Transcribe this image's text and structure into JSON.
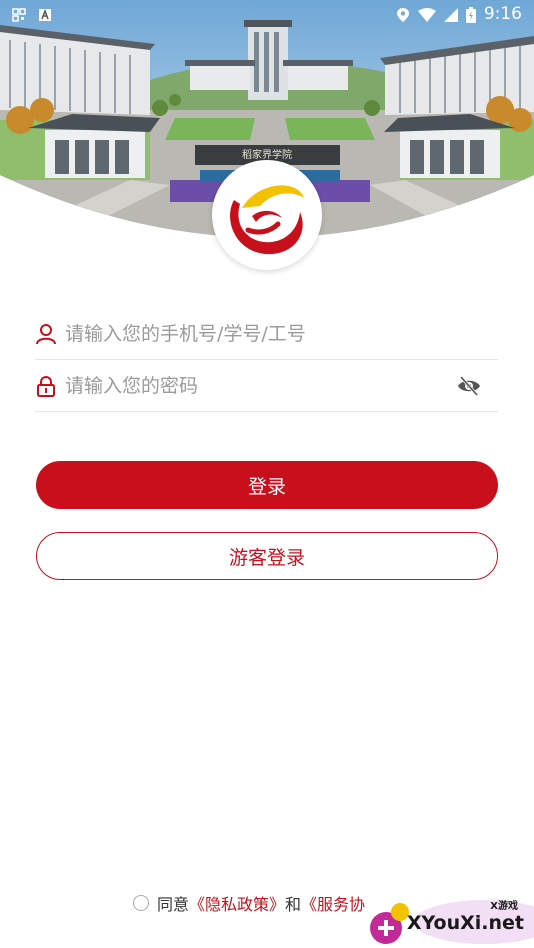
{
  "status_bar": {
    "time": "9:16"
  },
  "hero": {
    "building_sign": "稻家界学院"
  },
  "login": {
    "account_placeholder": "请输入您的手机号/学号/工号",
    "password_placeholder": "请输入您的密码",
    "login_label": "登录",
    "guest_label": "游客登录"
  },
  "agreement": {
    "agree_text": "同意",
    "privacy_link": "《隐私政策》",
    "and_text": "和",
    "service_link": "《服务协"
  },
  "watermark": {
    "brand": "XYouXi.net",
    "brand_small": "X游戏"
  },
  "colors": {
    "accent": "#c8101c",
    "logo_yellow": "#f2c200"
  },
  "icons": [
    "user-icon",
    "lock-icon",
    "eye-off-icon",
    "location-icon",
    "wifi-icon",
    "signal-icon",
    "battery-icon"
  ]
}
